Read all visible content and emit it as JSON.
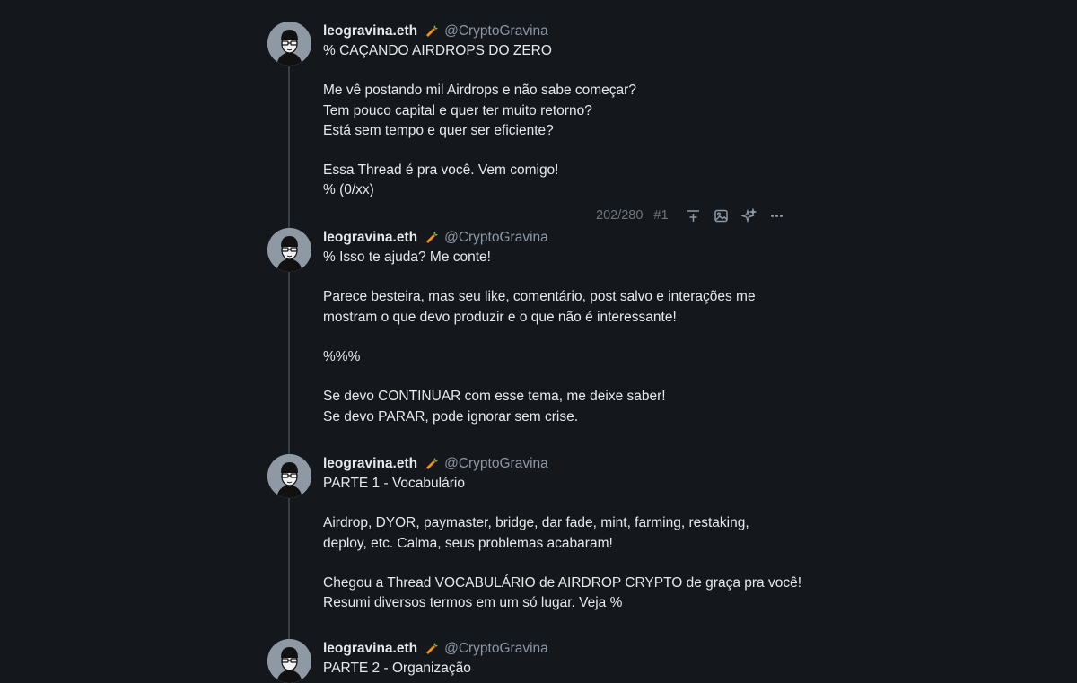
{
  "thread": {
    "posts": [
      {
        "display_name": "leogravina.eth",
        "emoji_icon": "carrot-icon",
        "handle": "@CryptoGravina",
        "text": "% CAÇANDO AIRDROPS DO ZERO\n\nMe vê postando mil Airdrops e não sabe começar?\nTem pouco capital e quer ter muito retorno?\nEstá sem tempo e quer ser eficiente?\n\nEssa Thread é pra você. Vem comigo!\n% (0/xx)"
      },
      {
        "display_name": "leogravina.eth",
        "emoji_icon": "carrot-icon",
        "handle": "@CryptoGravina",
        "text": "% Isso te ajuda? Me conte!\n\nParece besteira, mas seu like, comentário, post salvo e interações me\nmostram o que devo produzir e o que não é interessante!\n\n%%%\n\nSe devo CONTINUAR com esse tema, me deixe saber!\nSe devo PARAR, pode ignorar sem crise."
      },
      {
        "display_name": "leogravina.eth",
        "emoji_icon": "carrot-icon",
        "handle": "@CryptoGravina",
        "text": "PARTE 1 - Vocabulário\n\nAirdrop, DYOR, paymaster, bridge, dar fade, mint, farming, restaking,\ndeploy, etc. Calma, seus problemas acabaram!\n\nChegou a Thread VOCABULÁRIO de AIRDROP CRYPTO de graça pra você!\nResumi diversos termos em um só lugar. Veja %"
      },
      {
        "display_name": "leogravina.eth",
        "emoji_icon": "carrot-icon",
        "handle": "@CryptoGravina",
        "text": "PARTE 2 - Organização"
      }
    ]
  },
  "toolbar": {
    "char_counter": "202/280",
    "post_index": "#1",
    "icons": [
      "insert-post-icon",
      "image-icon",
      "sparkle-icon",
      "more-icon"
    ]
  },
  "colors": {
    "background": "#14171c",
    "text": "#e7e9ea",
    "muted": "#8b98a5",
    "thread_line": "#3a3f45"
  }
}
